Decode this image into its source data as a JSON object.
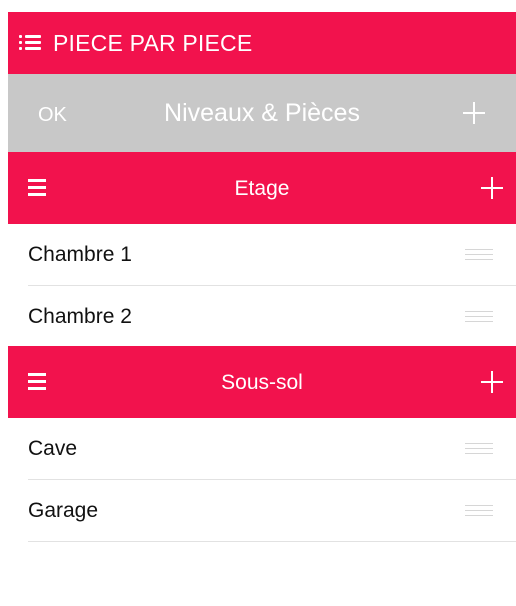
{
  "app_bar": {
    "title": "PIECE PAR PIECE",
    "menu_icon": "list-menu-icon",
    "color": "#f2124d"
  },
  "nav_bar": {
    "ok_label": "OK",
    "title": "Niveaux & Pièces",
    "add_icon": "plus-icon",
    "color": "#c8c8c8"
  },
  "sections": [
    {
      "title": "Etage",
      "items": [
        "Chambre 1",
        "Chambre 2"
      ]
    },
    {
      "title": "Sous-sol",
      "items": [
        "Cave",
        "Garage"
      ]
    }
  ]
}
